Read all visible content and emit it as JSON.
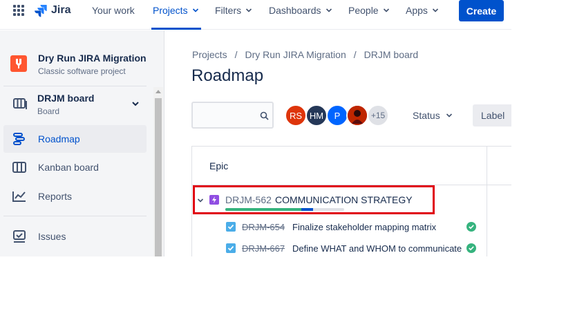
{
  "topnav": {
    "logo_text": "Jira",
    "items": [
      {
        "label": "Your work"
      },
      {
        "label": "Projects"
      },
      {
        "label": "Filters"
      },
      {
        "label": "Dashboards"
      },
      {
        "label": "People"
      },
      {
        "label": "Apps"
      }
    ],
    "create_label": "Create"
  },
  "sidebar": {
    "project_name": "Dry Run JIRA Migration",
    "project_type": "Classic software project",
    "board_name": "DRJM board",
    "board_sub": "Board",
    "items": [
      {
        "label": "Roadmap",
        "icon": "roadmap-icon"
      },
      {
        "label": "Kanban board",
        "icon": "kanban-icon"
      },
      {
        "label": "Reports",
        "icon": "reports-icon"
      },
      {
        "label": "Issues",
        "icon": "issues-icon"
      }
    ]
  },
  "breadcrumb": [
    "Projects",
    "Dry Run JIRA Migration",
    "DRJM board"
  ],
  "page_title": "Roadmap",
  "filters": {
    "avatars": [
      {
        "initials": "RS",
        "color": "#de350b"
      },
      {
        "initials": "HM",
        "color": "#253858"
      },
      {
        "initials": "P",
        "color": "#0065ff"
      },
      {
        "initials": "",
        "color": "#bf2600"
      }
    ],
    "more_count": "+15",
    "status_label": "Status",
    "label_button": "Label"
  },
  "roadmap": {
    "column_header": "Epic",
    "epic": {
      "key": "DRJM-562",
      "summary": "COMMUNICATION STRATEGY",
      "progress_done_fraction": 0.64,
      "progress_inprogress_fraction": 0.1
    },
    "issues": [
      {
        "key": "DRJM-654",
        "summary": "Finalize stakeholder mapping matrix",
        "status": "done"
      },
      {
        "key": "DRJM-667",
        "summary": "Define WHAT and WHOM to communicate",
        "status": "done"
      }
    ]
  },
  "colors": {
    "accent": "#0052cc",
    "highlight_border": "#e00010",
    "epic": "#904ee2",
    "done": "#36b37e"
  }
}
